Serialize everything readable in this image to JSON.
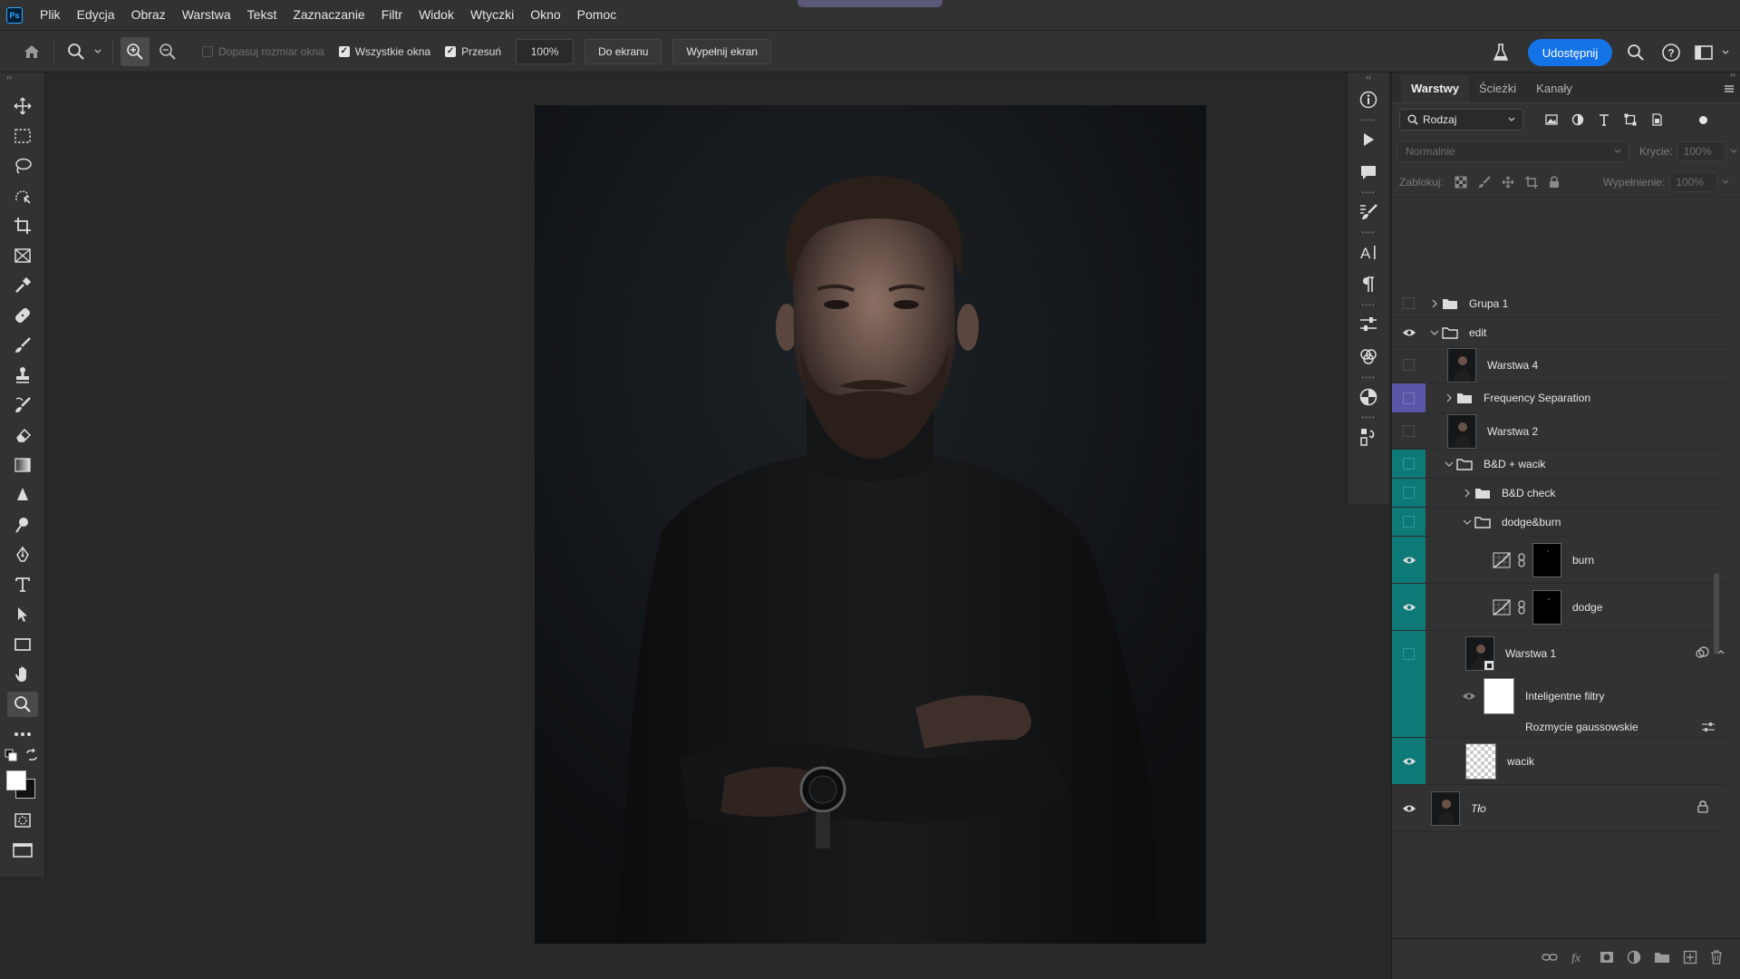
{
  "app": {
    "logo": "Ps"
  },
  "menu": [
    "Plik",
    "Edycja",
    "Obraz",
    "Warstwa",
    "Tekst",
    "Zaznaczanie",
    "Filtr",
    "Widok",
    "Wtyczki",
    "Okno",
    "Pomoc"
  ],
  "options": {
    "resize_windows": "Dopasuj rozmiar okna",
    "all_windows": "Wszystkie okna",
    "scrubby": "Przesuń",
    "zoom_value": "100%",
    "fit_screen": "Do ekranu",
    "fill_screen": "Wypełnij ekran",
    "share": "Udostępnij"
  },
  "layers_panel": {
    "tabs": [
      "Warstwy",
      "Ścieżki",
      "Kanały"
    ],
    "kind_filter": "Rodzaj",
    "blend_mode": "Normalnie",
    "opacity_label": "Krycie:",
    "opacity_value": "100%",
    "lock_label": "Zablokuj:",
    "fill_label": "Wypełnienie:",
    "fill_value": "100%",
    "layers": [
      {
        "name": "Grupa 1",
        "type": "group",
        "visible": false
      },
      {
        "name": "edit",
        "type": "group",
        "visible": true
      },
      {
        "name": "Warstwa 4",
        "type": "pixel",
        "visible": false
      },
      {
        "name": "Frequency Separation",
        "type": "group",
        "visible": false,
        "label_color": "violet"
      },
      {
        "name": "Warstwa 2",
        "type": "pixel",
        "visible": false
      },
      {
        "name": "B&D + wacik",
        "type": "group",
        "visible": false,
        "label_color": "teal"
      },
      {
        "name": "B&D check",
        "type": "group",
        "visible": false,
        "label_color": "teal"
      },
      {
        "name": "dodge&burn",
        "type": "group",
        "visible": false,
        "label_color": "teal"
      },
      {
        "name": "burn",
        "type": "adjustment",
        "visible": true,
        "label_color": "teal"
      },
      {
        "name": "dodge",
        "type": "adjustment",
        "visible": true,
        "label_color": "teal"
      },
      {
        "name": "Warstwa 1",
        "type": "smart-object",
        "visible": false,
        "label_color": "teal"
      },
      {
        "name": "Inteligentne filtry",
        "type": "smart-filters",
        "visible": true,
        "label_color": "teal"
      },
      {
        "name": "Rozmycie gaussowskie",
        "type": "filter",
        "label_color": "teal"
      },
      {
        "name": "wacik",
        "type": "transparent",
        "visible": true,
        "label_color": "teal"
      },
      {
        "name": "Tło",
        "type": "background",
        "visible": true
      }
    ]
  }
}
